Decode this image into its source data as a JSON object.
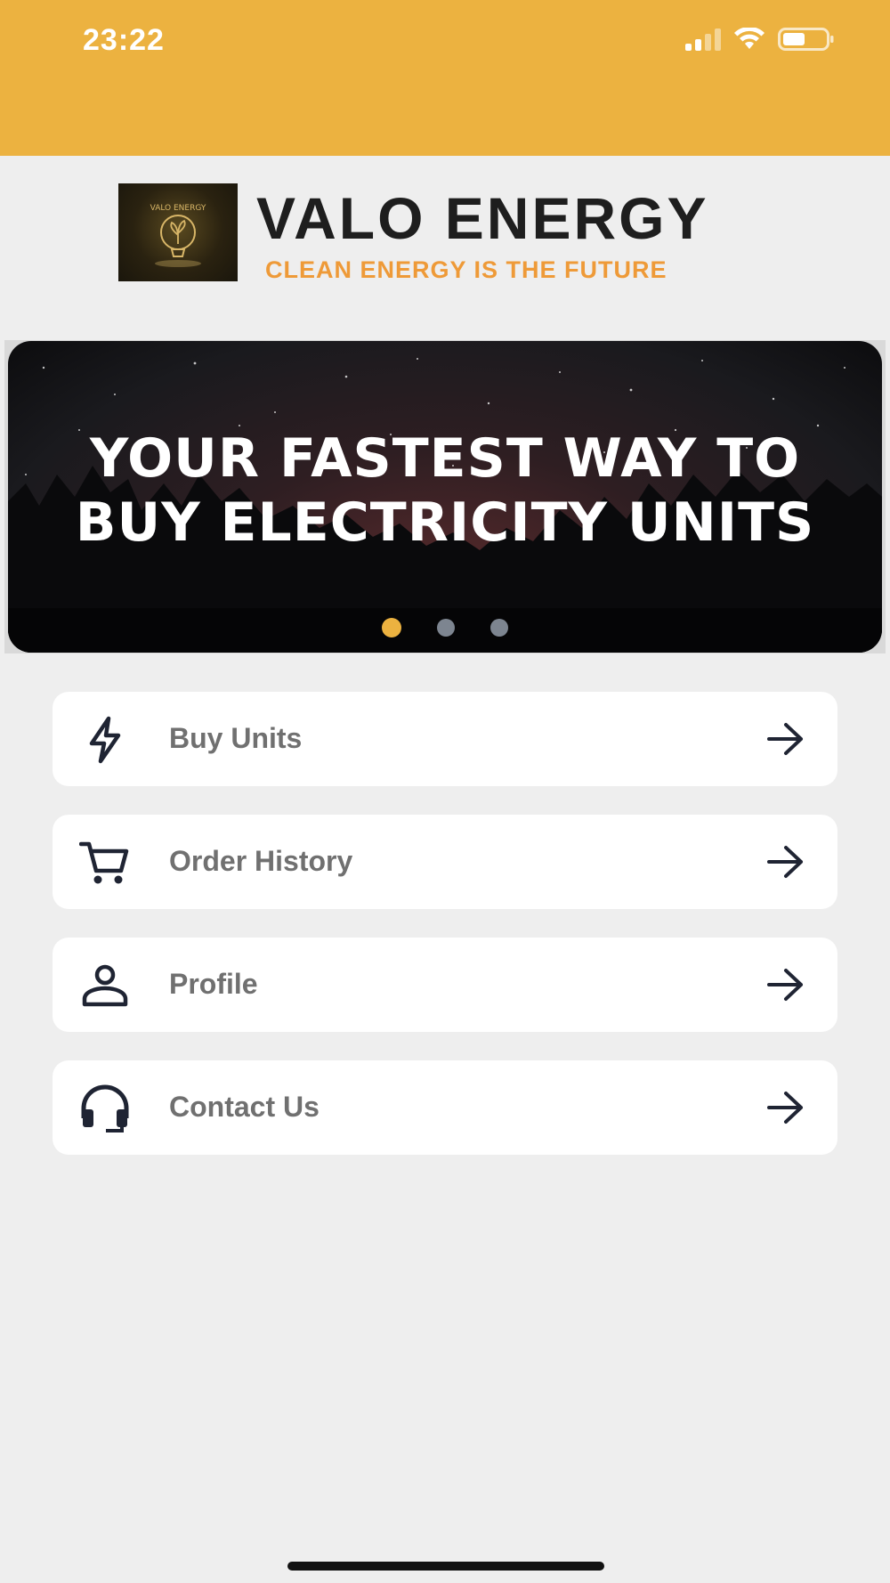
{
  "status_bar": {
    "time": "23:22",
    "icons": [
      "cellular-signal-icon",
      "wifi-icon",
      "battery-icon"
    ]
  },
  "logo": {
    "name": "VALO ENERGY",
    "tagline": "CLEAN ENERGY IS THE FUTURE",
    "mark_text": "VALO ENERGY"
  },
  "banner": {
    "headline_line1": "YOUR FASTEST WAY TO",
    "headline_line2": "BUY ELECTRICITY UNITS",
    "active_slide": 1,
    "slide_count": 3
  },
  "menu": [
    {
      "label": "Buy Units",
      "icon": "lightning-bolt-icon"
    },
    {
      "label": "Order History",
      "icon": "shopping-cart-icon"
    },
    {
      "label": "Profile",
      "icon": "person-icon"
    },
    {
      "label": "Contact Us",
      "icon": "headset-icon"
    }
  ],
  "colors": {
    "header": "#ecb240",
    "accent": "#ecb240",
    "tagline": "#ee9a38",
    "icon": "#1f2433",
    "label": "#707070",
    "background": "#eeeeee"
  }
}
